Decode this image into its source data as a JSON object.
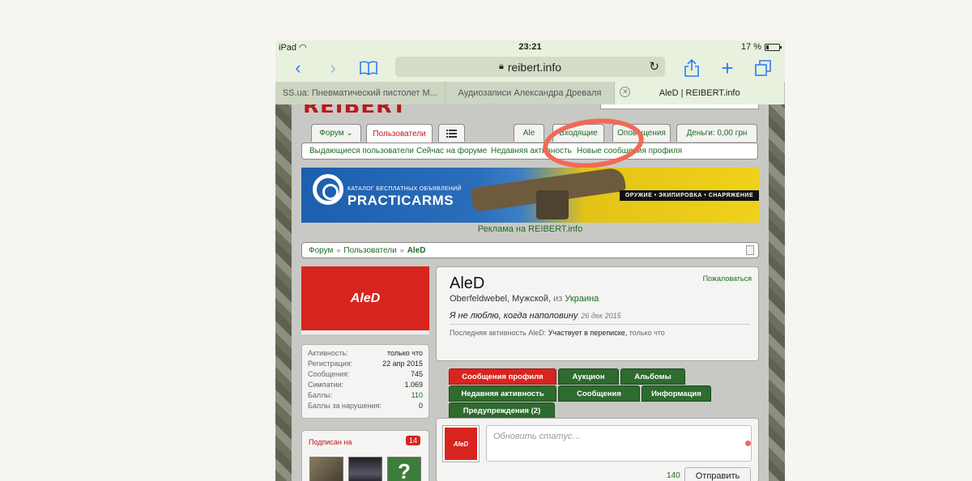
{
  "status_bar": {
    "device": "iPad",
    "time": "23:21",
    "battery": "17 %"
  },
  "browser": {
    "url": "reibert.info",
    "icons": {
      "back": "chevron-left-icon",
      "forward": "chevron-right-icon",
      "bookmarks": "book-icon",
      "lock": "lock-icon",
      "reload": "reload-icon",
      "share": "share-icon",
      "new_tab": "plus-icon",
      "tabs": "tabs-icon"
    },
    "tabs": [
      {
        "title": "SS.ua: Пневматический пистолет М..."
      },
      {
        "title": "Аудиозаписи Александра Древаля"
      },
      {
        "title": "AleD | REIBERT.info"
      }
    ]
  },
  "site": {
    "logo": "REIBERT",
    "nav": {
      "forum": "Форум",
      "users": "Пользователи",
      "user_short": "Ale",
      "inbox": "Входящие",
      "alerts": "Оповещения",
      "money": "Деньги: 0,00 грн"
    },
    "subnav": [
      "Выдающиеся пользователи",
      "Сейчас на форуме",
      "Недавняя активность",
      "Новые сообщения профиля"
    ],
    "banner": {
      "small_text": "КАТАЛОГ БЕСПЛАТНЫХ ОБЪЯВЛЕНИЙ",
      "title": "PRACTICARMS",
      "tagline": "ОРУЖИЕ • ЭКИПИРОВКА • СНАРЯЖЕНИЕ",
      "caption": "Реклама на REIBERT.info"
    },
    "breadcrumb": [
      "Форум",
      "Пользователи",
      "AleD"
    ],
    "profile": {
      "name": "AleD",
      "rank": "Oberfeldwebel",
      "gender": "Мужской",
      "from_word": "из",
      "country": "Украина",
      "status_text": "Я не люблю, когда наполовину",
      "status_date": "26 дек 2015",
      "last_activity_label": "Последняя активность AleD:",
      "last_activity_value": "Участвует в переписке,",
      "last_activity_time": "только что",
      "report": "Пожаловаться"
    },
    "stats": [
      {
        "label": "Активность:",
        "value": "только что"
      },
      {
        "label": "Регистрация:",
        "value": "22 апр 2015"
      },
      {
        "label": "Сообщения:",
        "value": "745"
      },
      {
        "label": "Симпатии:",
        "value": "1.069"
      },
      {
        "label": "Баллы:",
        "value": "110"
      },
      {
        "label": "Баллы за нарушения:",
        "value": "0"
      }
    ],
    "following": {
      "title": "Подписан на",
      "count": "14"
    },
    "profile_tabs": [
      "Сообщения профиля",
      "Аукцион",
      "Альбомы",
      "Недавняя активность",
      "Сообщения",
      "Информация",
      "Предупреждения (2)"
    ],
    "status_box": {
      "placeholder": "Обновить статус…",
      "char_count": "140",
      "send": "Отправить"
    }
  },
  "colors": {
    "accent_red": "#d8241f",
    "link_green": "#1e6b22",
    "annotation": "#f06a57"
  }
}
